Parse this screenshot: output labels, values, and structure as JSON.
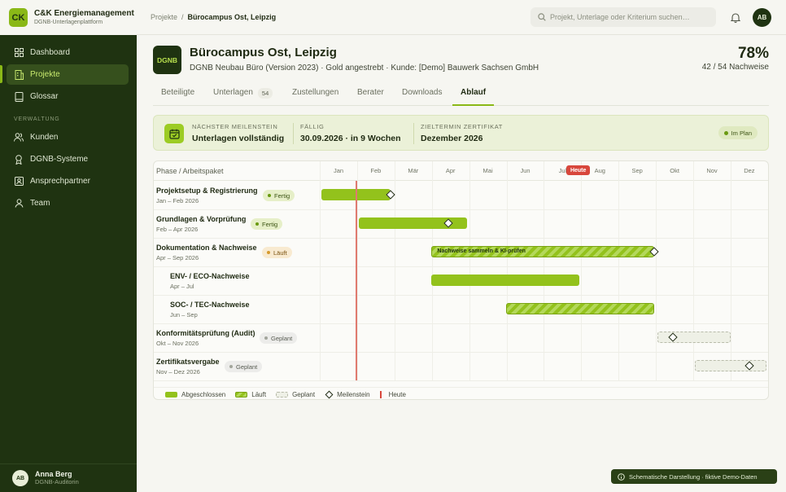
{
  "brand": {
    "logo": "CK",
    "title": "C&K Energiemanagement",
    "subtitle": "DGNB-Unterlagenplattform"
  },
  "sidebar": {
    "items": [
      {
        "label": "Dashboard",
        "icon": "dashboard-icon"
      },
      {
        "label": "Projekte",
        "icon": "building-icon",
        "active": true
      },
      {
        "label": "Glossar",
        "icon": "book-icon"
      }
    ],
    "section_label": "VERWALTUNG",
    "admin_items": [
      {
        "label": "Kunden",
        "icon": "users-icon"
      },
      {
        "label": "DGNB-Systeme",
        "icon": "award-icon"
      },
      {
        "label": "Ansprechpartner",
        "icon": "contact-card-icon"
      },
      {
        "label": "Team",
        "icon": "user-icon"
      }
    ],
    "user": {
      "initials": "AB",
      "name": "Anna Berg",
      "role": "DGNB-Auditorin"
    }
  },
  "topbar": {
    "breadcrumb": [
      "Projekte",
      "Bürocampus Ost, Leipzig"
    ],
    "search_placeholder": "Projekt, Unterlage oder Kriterium suchen…",
    "avatar": "AB"
  },
  "project": {
    "badge": "DGNB",
    "title": "Bürocampus Ost, Leipzig",
    "meta": "DGNB Neubau Büro (Version 2023) · Gold angestrebt · Kunde: [Demo] Bauwerk Sachsen GmbH",
    "progress_percent": "78%",
    "progress_detail": "42 / 54 Nachweise"
  },
  "tabs": [
    {
      "label": "Beteiligte"
    },
    {
      "label": "Unterlagen",
      "count": "54"
    },
    {
      "label": "Zustellungen"
    },
    {
      "label": "Berater"
    },
    {
      "label": "Downloads"
    },
    {
      "label": "Ablauf",
      "active": true
    }
  ],
  "milestone": {
    "next_label": "NÄCHSTER MEILENSTEIN",
    "next_value": "Unterlagen vollständig",
    "due_label": "FÄLLIG",
    "due_value": "30.09.2026 · in 9 Wochen",
    "target_label": "ZIELTERMIN ZERTIFIKAT",
    "target_value": "Dezember 2026",
    "status": "Im Plan"
  },
  "gantt": {
    "header": "Phase / Arbeitspaket",
    "months": [
      "Jan",
      "Feb",
      "Mär",
      "Apr",
      "Mai",
      "Jun",
      "Jul",
      "Aug",
      "Sep",
      "Okt",
      "Nov",
      "Dez"
    ],
    "today_label": "Heute",
    "today_month": 0.95,
    "rows": [
      {
        "title": "Projektsetup & Registrierung",
        "range": "Jan – Feb 2026",
        "status": "Fertig",
        "state": "done",
        "start": 0,
        "end": 1.9,
        "milestone": 1.9
      },
      {
        "title": "Grundlagen & Vorprüfung",
        "range": "Feb – Apr 2026",
        "status": "Fertig",
        "state": "done",
        "start": 1.0,
        "end": 3.95,
        "milestone": 3.45
      },
      {
        "title": "Dokumentation & Nachweise",
        "range": "Apr – Sep 2026",
        "status": "Läuft",
        "state": "run",
        "start": 2.95,
        "end": 8.95,
        "milestone": 8.95,
        "bar_label": "Nachweise sammeln & KI-prüfen"
      },
      {
        "title": "ENV- / ECO-Nachweise",
        "range": "Apr – Jul",
        "state": "done",
        "sub": true,
        "start": 2.95,
        "end": 6.95
      },
      {
        "title": "SOC- / TEC-Nachweise",
        "range": "Jun – Sep",
        "state": "run",
        "sub": true,
        "start": 4.95,
        "end": 8.95
      },
      {
        "title": "Konformitätsprüfung (Audit)",
        "range": "Okt – Nov 2026",
        "status": "Geplant",
        "state": "plan",
        "start": 9.0,
        "end": 11.0,
        "milestone": 9.45
      },
      {
        "title": "Zertifikatsvergabe",
        "range": "Nov – Dez 2026",
        "status": "Geplant",
        "state": "plan",
        "start": 10.0,
        "end": 11.95,
        "milestone": 11.5
      }
    ],
    "legend": {
      "done": "Abgeschlossen",
      "run": "Läuft",
      "plan": "Geplant",
      "milestone": "Meilenstein",
      "today": "Heute"
    }
  },
  "footnote": "Schematische Darstellung · fiktive Demo-Daten",
  "colors": {
    "accent": "#93c21c",
    "sidebar": "#1f3311",
    "today": "#d8473c"
  }
}
